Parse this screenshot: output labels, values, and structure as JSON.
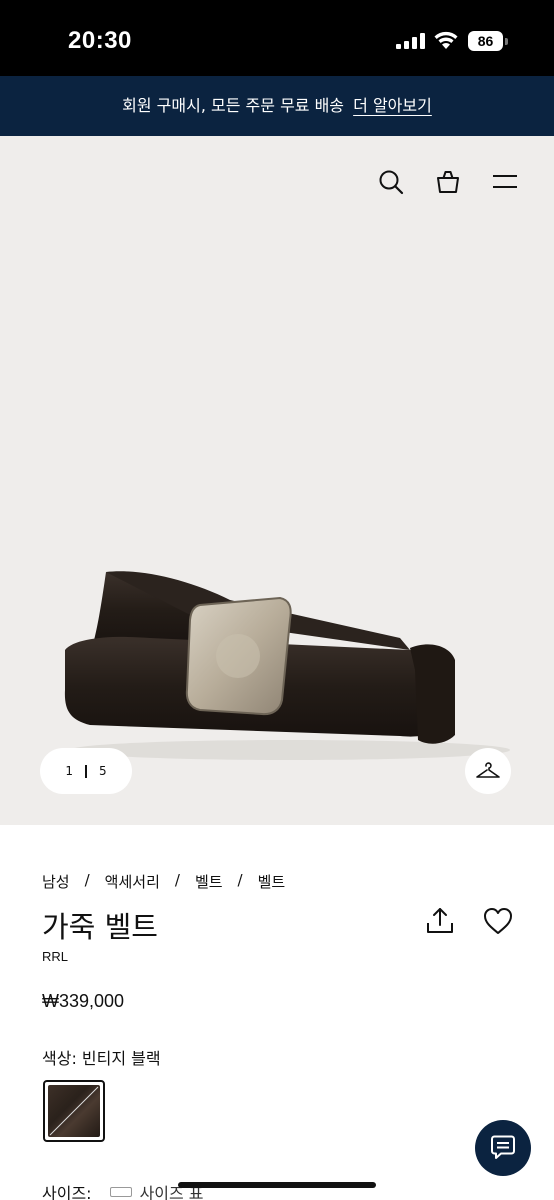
{
  "status": {
    "time": "20:30",
    "battery": "86"
  },
  "promo": {
    "text": "회원 구매시, 모든 주문 무료 배송",
    "link": "더 알아보기"
  },
  "header": {
    "icons": [
      "search-icon",
      "shopping-bag-icon",
      "menu-icon"
    ]
  },
  "gallery": {
    "current": "1",
    "total": "5"
  },
  "breadcrumb": [
    "남성",
    "액세서리",
    "벨트",
    "벨트"
  ],
  "breadcrumb_sep": "/",
  "product": {
    "title": "가죽 벨트",
    "brand": "RRL",
    "price": "₩339,000",
    "color_label": "색상: 빈티지 블랙",
    "size_label": "사이즈:",
    "size_guide": "사이즈 표"
  },
  "colors": {
    "brand_navy": "#0b2340",
    "hero_bg": "#efedeb"
  }
}
